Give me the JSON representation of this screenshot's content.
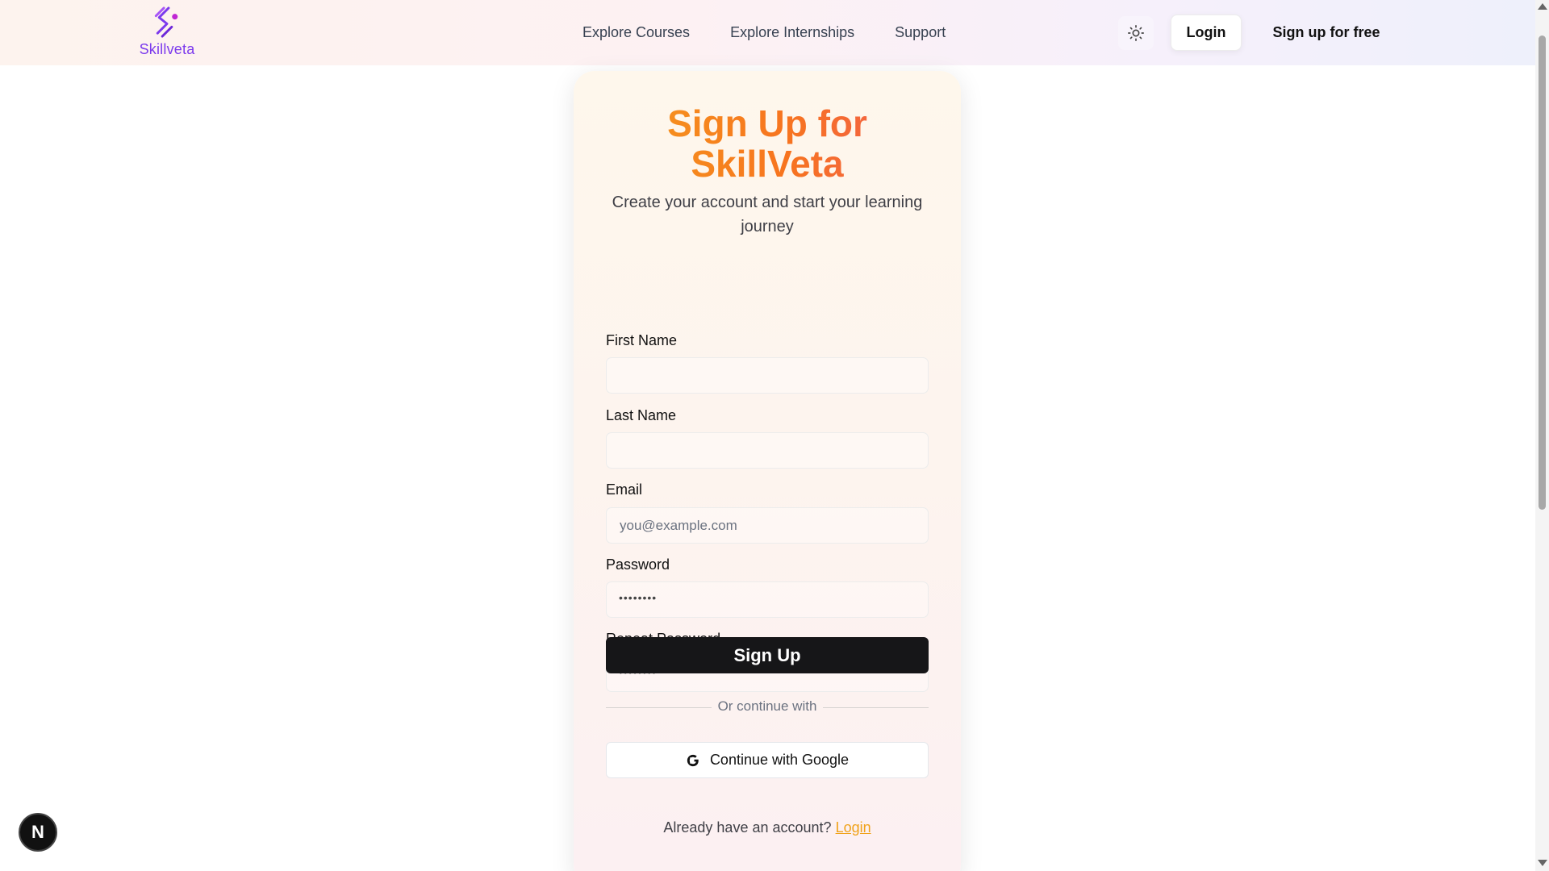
{
  "header": {
    "logo_text": "Skillveta",
    "nav": [
      "Explore Courses",
      "Explore Internships",
      "Support"
    ],
    "login_label": "Login",
    "signup_label": "Sign up for free"
  },
  "form": {
    "title_line1": "Sign Up for",
    "title_line2": "SkillVeta",
    "subtitle": "Create your account and start your learning journey",
    "first_name_label": "First Name",
    "first_name_value": "",
    "last_name_label": "Last Name",
    "last_name_value": "",
    "email_label": "Email",
    "email_placeholder": "you@example.com",
    "password_label": "Password",
    "password_mask": "••••••••",
    "repeat_password_label": "Repeat Password",
    "repeat_password_mask": "••••••••",
    "submit_label": "Sign Up",
    "divider_text": "Or continue with",
    "google_label": "Continue with Google",
    "already_text": "Already have an account?",
    "login_link": "Login"
  },
  "colors": {
    "accent": "#f0a21a",
    "brand": "#7c3aed",
    "button_dark": "#161618"
  },
  "badge": {
    "letter": "N"
  }
}
